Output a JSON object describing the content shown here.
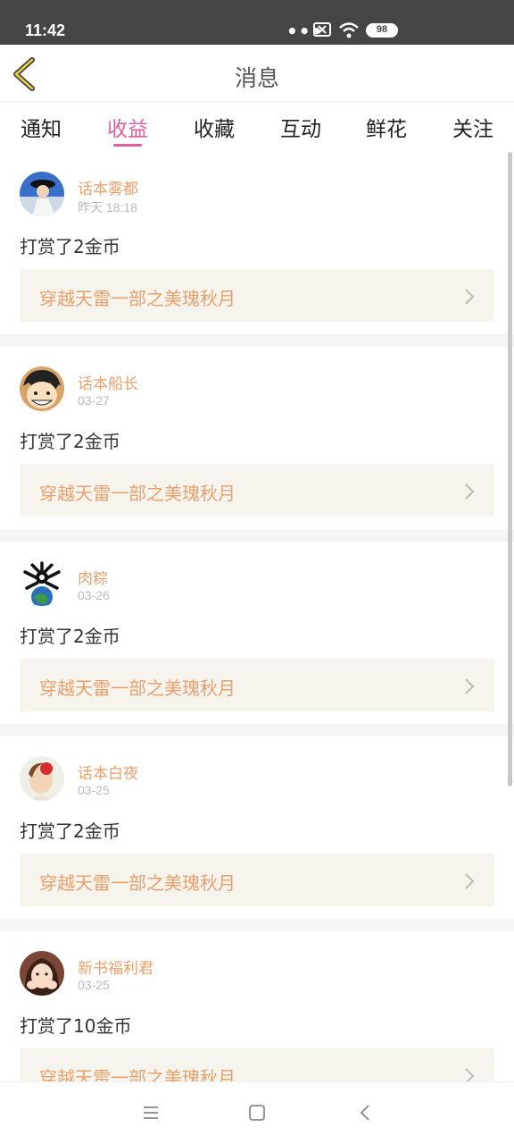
{
  "status_bar": {
    "time": "11:42",
    "battery": "98"
  },
  "header": {
    "title": "消息"
  },
  "tabs": [
    {
      "label": "通知"
    },
    {
      "label": "收益"
    },
    {
      "label": "收藏"
    },
    {
      "label": "互动"
    },
    {
      "label": "鲜花"
    },
    {
      "label": "关注"
    }
  ],
  "active_tab": "收益",
  "messages": [
    {
      "user": "话本雾都",
      "time": "昨天 18:18",
      "text": "打赏了2金币",
      "book": "穿越天雷一部之美瑰秋月"
    },
    {
      "user": "话本船长",
      "time": "03-27",
      "text": "打赏了2金币",
      "book": "穿越天雷一部之美瑰秋月"
    },
    {
      "user": "肉粽",
      "time": "03-26",
      "text": "打赏了2金币",
      "book": "穿越天雷一部之美瑰秋月"
    },
    {
      "user": "话本白夜",
      "time": "03-25",
      "text": "打赏了2金币",
      "book": "穿越天雷一部之美瑰秋月"
    },
    {
      "user": "新书福利君",
      "time": "03-25",
      "text": "打赏了10金币",
      "book": "穿越天雷一部之美瑰秋月"
    }
  ],
  "colors": {
    "accent": "#e0609a",
    "username": "#e8a06c",
    "book_bg": "#f6f4ec",
    "status_bar": "#454545"
  }
}
